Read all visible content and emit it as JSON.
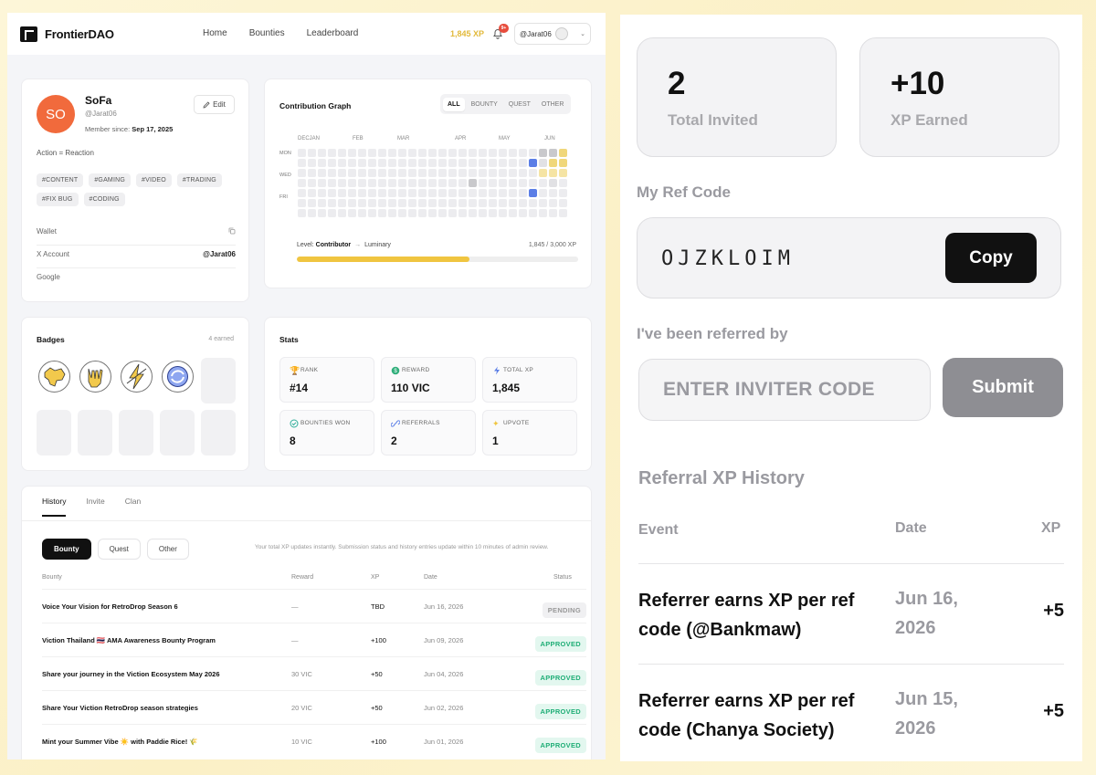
{
  "nav": {
    "brand": "FrontierDAO",
    "links": [
      "Home",
      "Bounties",
      "Leaderboard"
    ],
    "xp": "1,845 XP",
    "notif_count": "9+",
    "user": "@Jarat06"
  },
  "profile": {
    "initials": "SO",
    "name": "SoFa",
    "handle": "@Jarat06",
    "member_label": "Member since:",
    "member_date": "Sep 17, 2025",
    "edit_label": "Edit",
    "motto": "Action = Reaction",
    "tags": [
      "#CONTENT",
      "#GAMING",
      "#VIDEO",
      "#TRADING",
      "#FIX BUG",
      "#CODING"
    ],
    "wallet_label": "Wallet",
    "x_label": "X Account",
    "x_value": "@Jarat06",
    "google_label": "Google"
  },
  "graph": {
    "title": "Contribution Graph",
    "filters": [
      "ALL",
      "BOUNTY",
      "QUEST",
      "OTHER"
    ],
    "active_filter": "ALL",
    "months": [
      "DECJAN",
      "FEB",
      "MAR",
      "APR",
      "MAY",
      "JUN"
    ],
    "days": [
      "MON",
      "WED",
      "FRI"
    ],
    "level_label": "Level:",
    "level": "Contributor",
    "next_level": "Luminary",
    "xp_progress_text": "1,845 / 3,000 XP",
    "xp_current": 1845,
    "xp_target": 3000
  },
  "badges": {
    "title": "Badges",
    "earned": "4 earned"
  },
  "stats": {
    "title": "Stats",
    "items": [
      {
        "label": "RANK",
        "value": "#14",
        "icon": "trophy-icon"
      },
      {
        "label": "REWARD",
        "value": "110 VIC",
        "icon": "coin-icon"
      },
      {
        "label": "TOTAL XP",
        "value": "1,845",
        "icon": "bolt-icon"
      },
      {
        "label": "BOUNTIES WON",
        "value": "8",
        "icon": "check-circle-icon"
      },
      {
        "label": "REFERRALS",
        "value": "2",
        "icon": "link-icon"
      },
      {
        "label": "UPVOTE",
        "value": "1",
        "icon": "sparkle-icon"
      }
    ]
  },
  "history": {
    "tabs": [
      "History",
      "Invite",
      "Clan"
    ],
    "chips": [
      "Bounty",
      "Quest",
      "Other"
    ],
    "note": "Your total XP updates instantly. Submission status and history entries update within 10 minutes of admin review.",
    "columns": [
      "Bounty",
      "Reward",
      "XP",
      "Date",
      "Status"
    ],
    "rows": [
      {
        "bounty": "Voice Your Vision for RetroDrop Season 6",
        "reward": "—",
        "xp": "TBD",
        "date": "Jun 16, 2026",
        "status": "PENDING"
      },
      {
        "bounty": "Viction Thailand 🇹🇭 AMA Awareness Bounty Program",
        "reward": "—",
        "xp": "+100",
        "date": "Jun 09, 2026",
        "status": "APPROVED"
      },
      {
        "bounty": "Share your journey in the Viction Ecosystem May 2026",
        "reward": "30 VIC",
        "xp": "+50",
        "date": "Jun 04, 2026",
        "status": "APPROVED"
      },
      {
        "bounty": "Share Your Viction RetroDrop season strategies",
        "reward": "20 VIC",
        "xp": "+50",
        "date": "Jun 02, 2026",
        "status": "APPROVED"
      },
      {
        "bounty": "Mint your Summer Vibe ☀️ with Paddie Rice! 🌾",
        "reward": "10 VIC",
        "xp": "+100",
        "date": "Jun 01, 2026",
        "status": "APPROVED"
      }
    ]
  },
  "referral": {
    "total_invited": "2",
    "total_invited_label": "Total Invited",
    "xp_earned": "+10",
    "xp_earned_label": "XP Earned",
    "ref_code_label": "My Ref Code",
    "ref_code": "OJZKLOIM",
    "copy_label": "Copy",
    "referred_by_label": "I've been referred by",
    "inviter_placeholder": "ENTER INVITER CODE",
    "submit_label": "Submit",
    "history_title": "Referral XP History",
    "columns": [
      "Event",
      "Date",
      "XP"
    ],
    "rows": [
      {
        "event": "Referrer earns XP per ref code (@Bankmaw)",
        "date": "Jun 16, 2026",
        "xp": "+5"
      },
      {
        "event": "Referrer earns XP per ref code (Chanya Society)",
        "date": "Jun 15, 2026",
        "xp": "+5"
      }
    ]
  },
  "colors": {
    "accent_yellow": "#f0c540",
    "avatar_orange": "#f16a3c",
    "approved_green": "#1fae76",
    "graph_blue": "#5b7ee6"
  }
}
